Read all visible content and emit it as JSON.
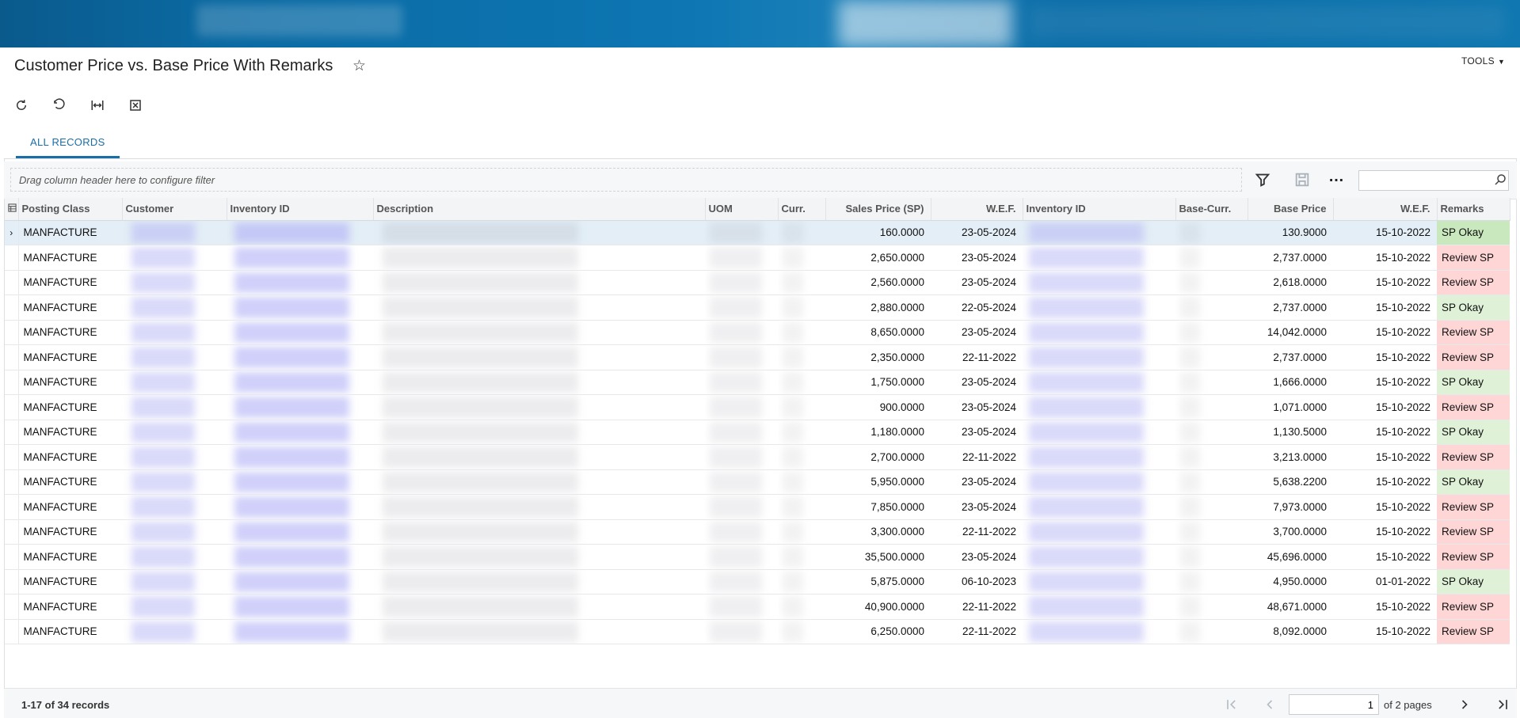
{
  "header": {
    "title": "Customer Price vs. Base Price With Remarks",
    "star_icon": "star-outline-icon",
    "tools_label": "TOOLS"
  },
  "toolbar": {
    "buttons": [
      "refresh-icon",
      "undo-icon",
      "fit-columns-icon",
      "export-excel-icon"
    ]
  },
  "tabs": [
    {
      "label": "ALL RECORDS",
      "active": true
    }
  ],
  "filterbar": {
    "dropzone_text": "Drag column header here to configure filter",
    "search_placeholder": ""
  },
  "grid": {
    "columns": [
      "Posting Class",
      "Customer",
      "Inventory ID",
      "Description",
      "UOM",
      "Curr.",
      "Sales Price (SP)",
      "W.E.F.",
      "Inventory ID",
      "Base-Curr.",
      "Base Price",
      "W.E.F.",
      "Remarks"
    ],
    "rows": [
      {
        "posting_class": "MANFACTURE",
        "sales_price": "160.0000",
        "wef": "23-05-2024",
        "base_price": "130.9000",
        "base_wef": "15-10-2022",
        "remarks": "SP Okay",
        "status": "ok"
      },
      {
        "posting_class": "MANFACTURE",
        "sales_price": "2,650.0000",
        "wef": "23-05-2024",
        "base_price": "2,737.0000",
        "base_wef": "15-10-2022",
        "remarks": "Review SP",
        "status": "review"
      },
      {
        "posting_class": "MANFACTURE",
        "sales_price": "2,560.0000",
        "wef": "23-05-2024",
        "base_price": "2,618.0000",
        "base_wef": "15-10-2022",
        "remarks": "Review SP",
        "status": "review"
      },
      {
        "posting_class": "MANFACTURE",
        "sales_price": "2,880.0000",
        "wef": "22-05-2024",
        "base_price": "2,737.0000",
        "base_wef": "15-10-2022",
        "remarks": "SP Okay",
        "status": "ok"
      },
      {
        "posting_class": "MANFACTURE",
        "sales_price": "8,650.0000",
        "wef": "23-05-2024",
        "base_price": "14,042.0000",
        "base_wef": "15-10-2022",
        "remarks": "Review SP",
        "status": "review"
      },
      {
        "posting_class": "MANFACTURE",
        "sales_price": "2,350.0000",
        "wef": "22-11-2022",
        "base_price": "2,737.0000",
        "base_wef": "15-10-2022",
        "remarks": "Review SP",
        "status": "review"
      },
      {
        "posting_class": "MANFACTURE",
        "sales_price": "1,750.0000",
        "wef": "23-05-2024",
        "base_price": "1,666.0000",
        "base_wef": "15-10-2022",
        "remarks": "SP Okay",
        "status": "ok"
      },
      {
        "posting_class": "MANFACTURE",
        "sales_price": "900.0000",
        "wef": "23-05-2024",
        "base_price": "1,071.0000",
        "base_wef": "15-10-2022",
        "remarks": "Review SP",
        "status": "review"
      },
      {
        "posting_class": "MANFACTURE",
        "sales_price": "1,180.0000",
        "wef": "23-05-2024",
        "base_price": "1,130.5000",
        "base_wef": "15-10-2022",
        "remarks": "SP Okay",
        "status": "ok"
      },
      {
        "posting_class": "MANFACTURE",
        "sales_price": "2,700.0000",
        "wef": "22-11-2022",
        "base_price": "3,213.0000",
        "base_wef": "15-10-2022",
        "remarks": "Review SP",
        "status": "review"
      },
      {
        "posting_class": "MANFACTURE",
        "sales_price": "5,950.0000",
        "wef": "23-05-2024",
        "base_price": "5,638.2200",
        "base_wef": "15-10-2022",
        "remarks": "SP Okay",
        "status": "ok"
      },
      {
        "posting_class": "MANFACTURE",
        "sales_price": "7,850.0000",
        "wef": "23-05-2024",
        "base_price": "7,973.0000",
        "base_wef": "15-10-2022",
        "remarks": "Review SP",
        "status": "review"
      },
      {
        "posting_class": "MANFACTURE",
        "sales_price": "3,300.0000",
        "wef": "22-11-2022",
        "base_price": "3,700.0000",
        "base_wef": "15-10-2022",
        "remarks": "Review SP",
        "status": "review"
      },
      {
        "posting_class": "MANFACTURE",
        "sales_price": "35,500.0000",
        "wef": "23-05-2024",
        "base_price": "45,696.0000",
        "base_wef": "15-10-2022",
        "remarks": "Review SP",
        "status": "review"
      },
      {
        "posting_class": "MANFACTURE",
        "sales_price": "5,875.0000",
        "wef": "06-10-2023",
        "base_price": "4,950.0000",
        "base_wef": "01-01-2022",
        "remarks": "SP Okay",
        "status": "ok"
      },
      {
        "posting_class": "MANFACTURE",
        "sales_price": "40,900.0000",
        "wef": "22-11-2022",
        "base_price": "48,671.0000",
        "base_wef": "15-10-2022",
        "remarks": "Review SP",
        "status": "review"
      },
      {
        "posting_class": "MANFACTURE",
        "sales_price": "6,250.0000",
        "wef": "22-11-2022",
        "base_price": "8,092.0000",
        "base_wef": "15-10-2022",
        "remarks": "Review SP",
        "status": "review"
      }
    ]
  },
  "footer": {
    "record_count": "1-17 of 34 records",
    "current_page": "1",
    "pages_label": "of 2 pages"
  },
  "colors": {
    "accent": "#1a6ea8",
    "ok_bg": "#dff2d8",
    "review_bg": "#ffd6d6",
    "topbar": "#0b6aa3"
  }
}
